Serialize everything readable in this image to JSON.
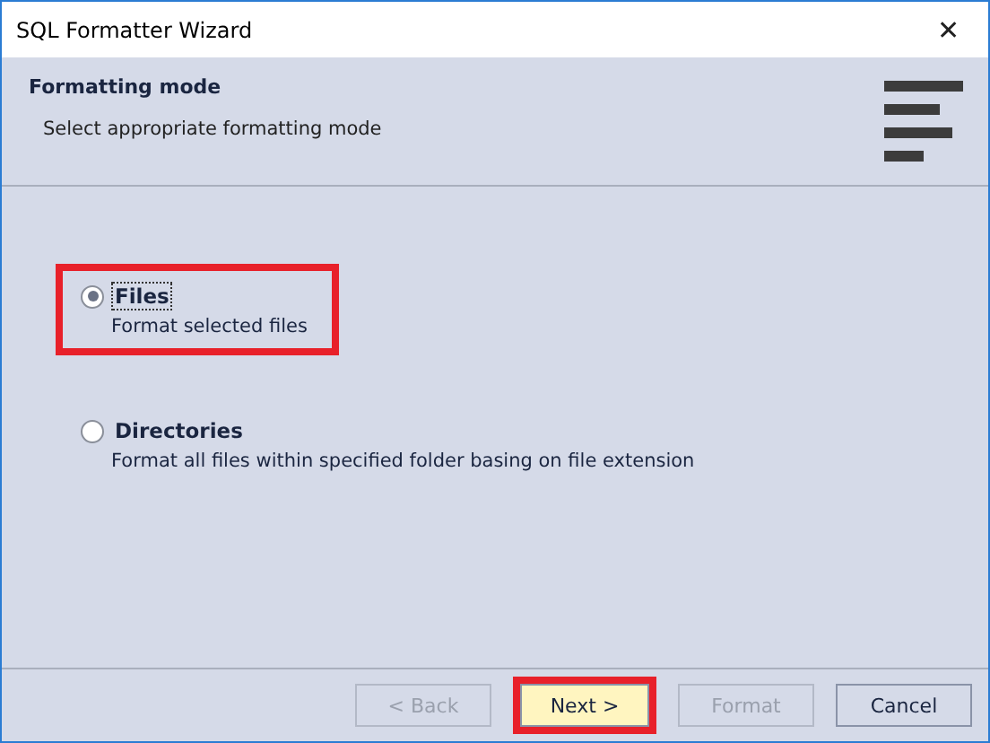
{
  "window": {
    "title": "SQL Formatter Wizard",
    "close": "✕"
  },
  "header": {
    "title": "Formatting mode",
    "subtitle": "Select appropriate formatting mode"
  },
  "options": [
    {
      "label": "Files",
      "description": "Format selected files",
      "selected": true,
      "highlighted": true
    },
    {
      "label": "Directories",
      "description": "Format all files within specified folder basing on file extension",
      "selected": false,
      "highlighted": false
    }
  ],
  "buttons": [
    {
      "label": "< Back",
      "disabled": true,
      "highlighted": false
    },
    {
      "label": "Next >",
      "disabled": false,
      "highlighted": true
    },
    {
      "label": "Format",
      "disabled": true,
      "highlighted": false
    },
    {
      "label": "Cancel",
      "disabled": false,
      "highlighted": false
    }
  ]
}
